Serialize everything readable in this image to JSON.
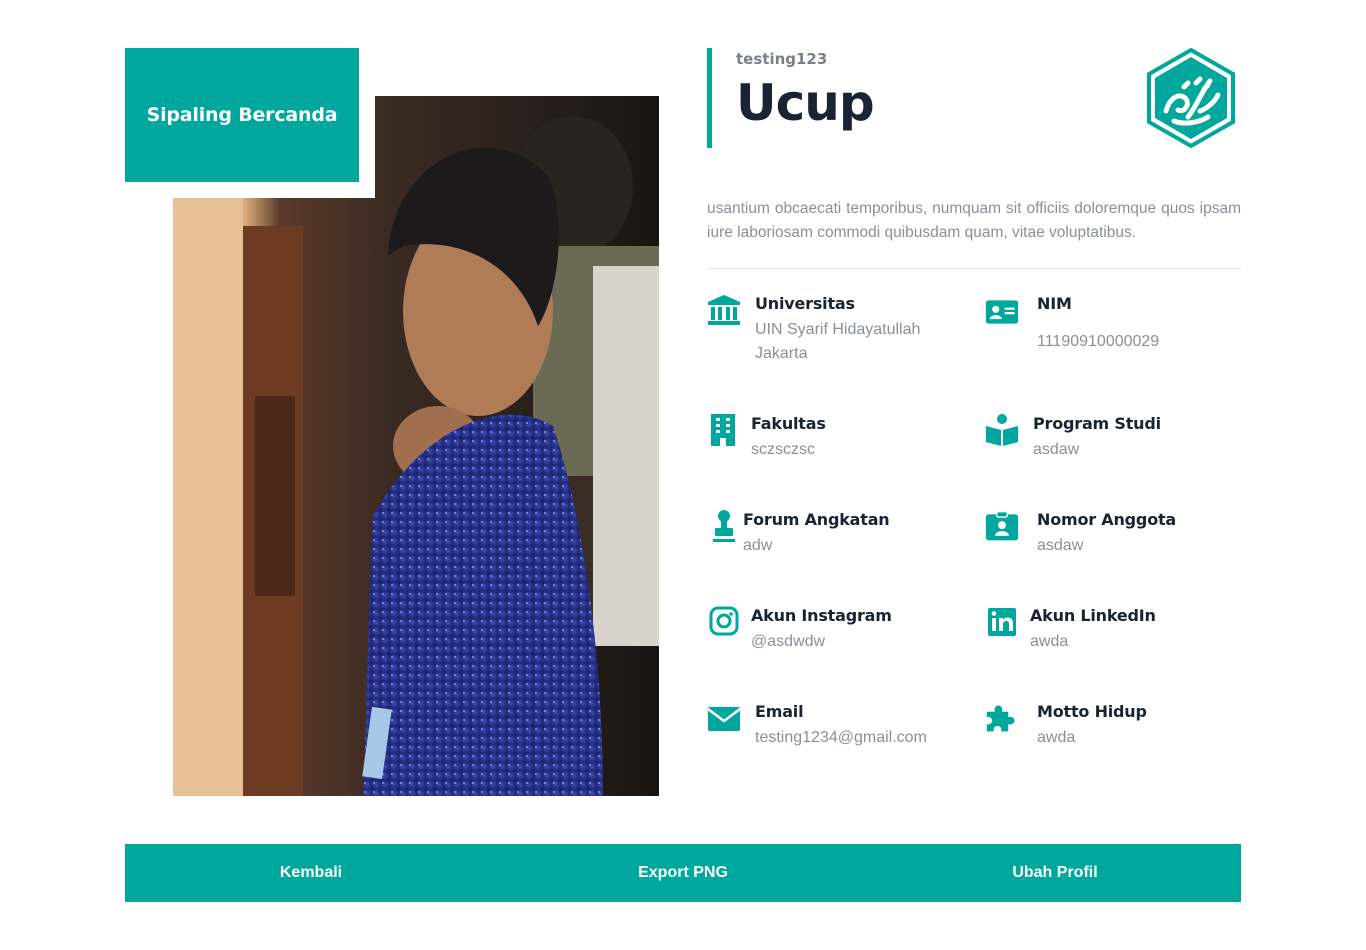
{
  "profile": {
    "nickname": "Sipaling Bercanda",
    "username": "testing123",
    "name": "Ucup",
    "bio": "usantium obcaecati temporibus, numquam sit officiis doloremque quos ipsam iure laboriosam commodi quibusdam quam, vitae voluptatibus."
  },
  "info": {
    "universitas": {
      "label": "Universitas",
      "value": "UIN Syarif Hidayatullah Jakarta",
      "icon": "institution-icon"
    },
    "nim": {
      "label": "NIM",
      "value": "11190910000029",
      "icon": "id-card-icon"
    },
    "fakultas": {
      "label": "Fakultas",
      "value": "sczsczsc",
      "icon": "building-icon"
    },
    "prodi": {
      "label": "Program Studi",
      "value": "asdaw",
      "icon": "reader-icon"
    },
    "forum": {
      "label": "Forum Angkatan",
      "value": "adw",
      "icon": "stamp-icon"
    },
    "nomor": {
      "label": "Nomor Anggota",
      "value": "asdaw",
      "icon": "id-badge-icon"
    },
    "instagram": {
      "label": "Akun Instagram",
      "value": "@asdwdw",
      "icon": "instagram-icon"
    },
    "linkedin": {
      "label": "Akun LinkedIn",
      "value": "awda",
      "icon": "linkedin-icon"
    },
    "email": {
      "label": "Email",
      "value": "testing1234@gmail.com",
      "icon": "envelope-icon"
    },
    "motto": {
      "label": "Motto Hidup",
      "value": "awda",
      "icon": "puzzle-icon"
    }
  },
  "actions": {
    "back": "Kembali",
    "export": "Export PNG",
    "edit": "Ubah Profil"
  },
  "colors": {
    "accent": "#00a79d",
    "heading": "#1b2233",
    "muted": "#8a8f98"
  }
}
